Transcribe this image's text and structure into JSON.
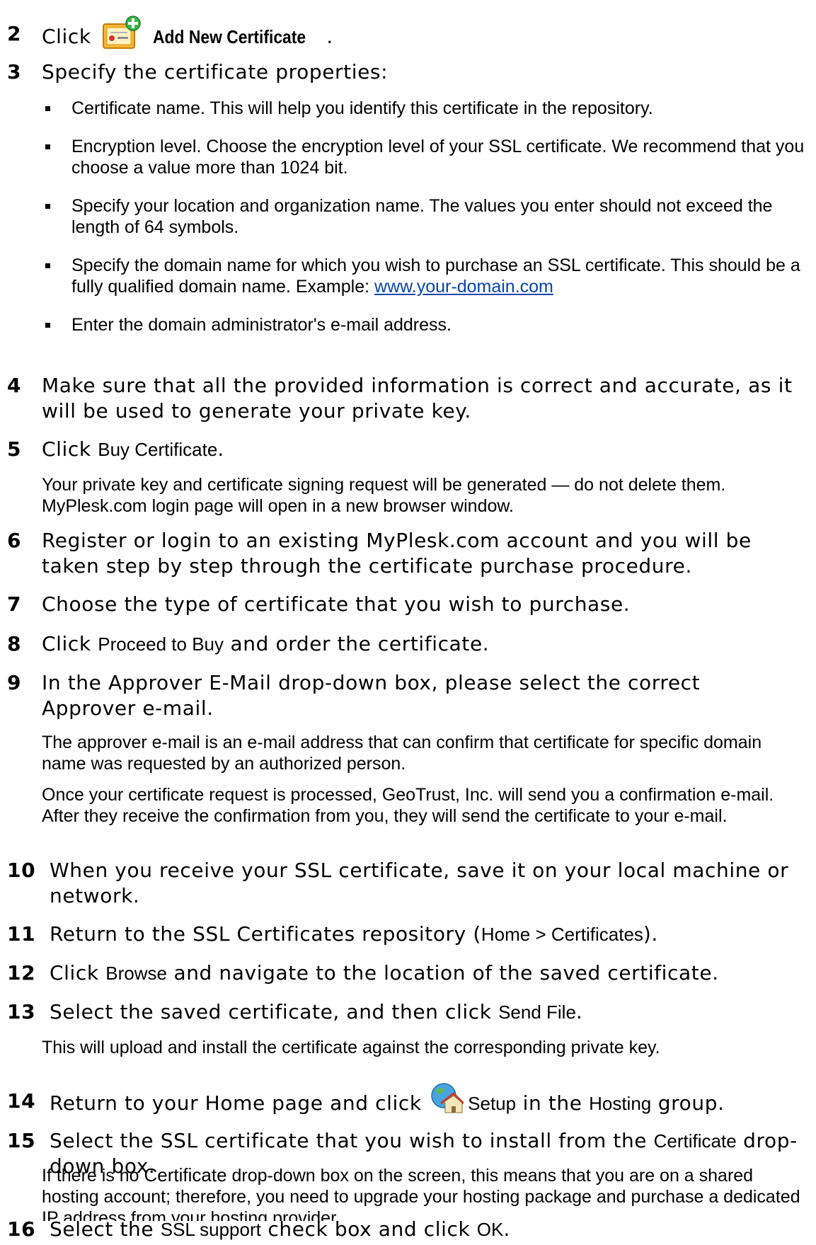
{
  "steps": {
    "s2": {
      "num": "2",
      "pre": "Click",
      "ui": "Add New Certificate",
      "post": ".",
      "icon": "add-certificate-icon"
    },
    "s3": {
      "num": "3",
      "text": "Specify the certificate properties:"
    },
    "bullets": [
      {
        "text": "Certificate name. This will help you identify this certificate in the repository."
      },
      {
        "text": "Encryption level. Choose the encryption level of your SSL certificate. We recommend that you choose a value more than 1024 bit."
      },
      {
        "text": "Specify your location and organization name. The values you enter should not exceed the length of 64 symbols."
      },
      {
        "text": "Specify the domain name for which you wish to purchase an SSL certificate. This should be a fully qualified domain name. Example: ",
        "link": "www.your-domain.com"
      },
      {
        "text": "Enter the domain administrator's e-mail address."
      }
    ],
    "s4": {
      "num": "4",
      "text": "Make sure that all the provided information is correct and accurate, as it will be used to generate your private key."
    },
    "s5": {
      "num": "5",
      "pre": "Click ",
      "ui": "Buy Certificate",
      "post": "."
    },
    "p5": "Your private key and certificate signing request will be generated — do not delete them. MyPlesk.com login page will open in a new browser window.",
    "s6": {
      "num": "6",
      "text": "Register or login to an existing MyPlesk.com account and you will be taken step by step through the certificate purchase procedure."
    },
    "s7": {
      "num": "7",
      "text": "Choose the type of certificate that you wish to purchase."
    },
    "s8": {
      "num": "8",
      "pre": "Click ",
      "ui": "Proceed to Buy",
      "post": " and order the certificate."
    },
    "s9": {
      "num": "9",
      "text": "In the Approver E-Mail drop-down box, please select the correct Approver e-mail."
    },
    "p9a": "The approver e-mail is an e-mail address that can confirm that certificate for specific domain name was requested by an authorized person.",
    "p9b": "Once your certificate request is processed, GeoTrust, Inc. will send you a confirmation e-mail. After they receive the confirmation from you, they will send the certificate to your e-mail.",
    "s10": {
      "num": "10",
      "text": "When you receive your SSL certificate, save it on your local machine or network."
    },
    "s11": {
      "num": "11",
      "pre": "Return to the SSL Certificates repository (",
      "ui": "Home > Certificates",
      "post": ")."
    },
    "s12": {
      "num": "12",
      "pre": "Click ",
      "ui": "Browse",
      "post": " and navigate to the location of the saved certificate."
    },
    "s13": {
      "num": "13",
      "pre": "Select the saved certificate, and then click ",
      "ui": "Send File",
      "post": "."
    },
    "p13": "This will upload and install the certificate against the corresponding private key.",
    "s14": {
      "num": "14",
      "pre": "Return to your Home page and click ",
      "ui": "Setup",
      "mid": " in the ",
      "ui2": "Hosting",
      "post": " group.",
      "icon": "hosting-setup-icon"
    },
    "s15": {
      "num": "15",
      "pre": "Select the SSL certificate that you wish to install from the ",
      "ui": "Certificate",
      "post": " drop-down box."
    },
    "p15": {
      "pre": "If there is no ",
      "ui": "Certificate",
      "post": " drop-down box on the screen, this means that you are on a shared hosting account; therefore, you need to upgrade your hosting package and purchase a dedicated IP address from your hosting provider."
    },
    "s16": {
      "num": "16",
      "pre": "Select the ",
      "ui": "SSL support",
      "mid": " check box and click ",
      "ui2": "OK",
      "post": "."
    }
  }
}
